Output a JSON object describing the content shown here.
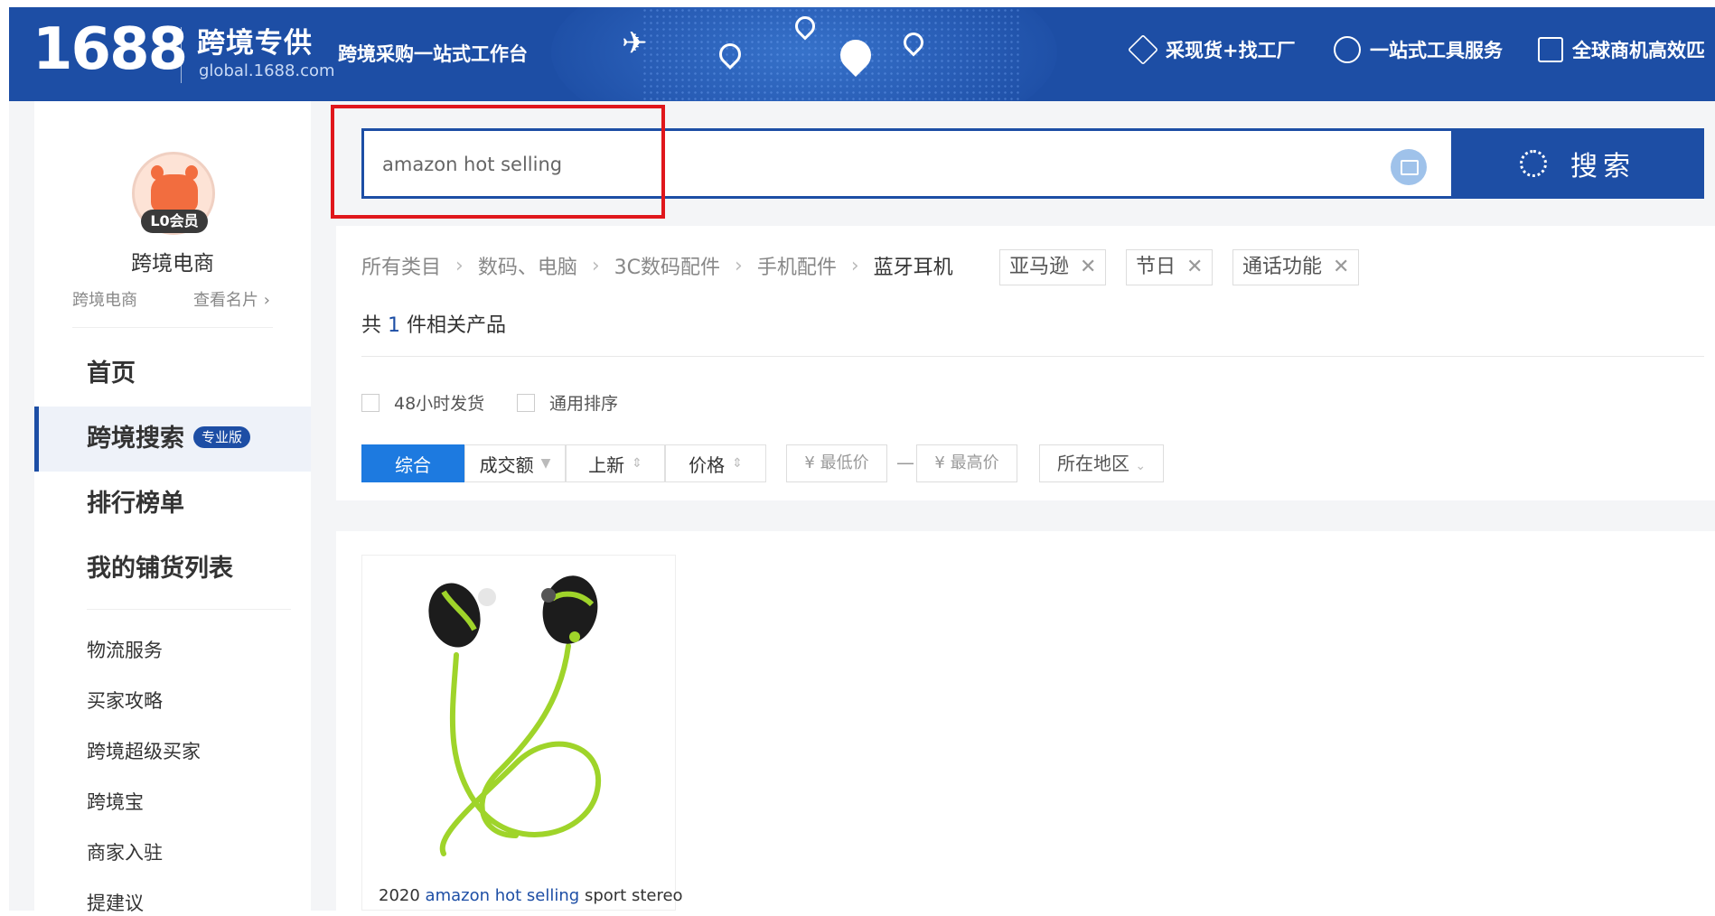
{
  "header": {
    "logo_number": "1688",
    "logo_title": "跨境专供",
    "logo_domain": "global.1688.com",
    "slogan": "跨境采购一站式工作台",
    "nav": [
      {
        "label": "采现货+找工厂",
        "icon": "diamond-icon"
      },
      {
        "label": "一站式工具服务",
        "icon": "pie-chart-icon"
      },
      {
        "label": "全球商机高效匹",
        "icon": "box-icon"
      }
    ]
  },
  "sidebar": {
    "member_badge": "L0会员",
    "user_name": "跨境电商",
    "user_type": "跨境电商",
    "view_card": "查看名片",
    "menu": [
      {
        "label": "首页"
      },
      {
        "label": "跨境搜索",
        "badge": "专业版"
      },
      {
        "label": "排行榜单"
      },
      {
        "label": "我的铺货列表"
      }
    ],
    "sub_items": [
      "物流服务",
      "买家攻略",
      "跨境超级买家",
      "跨境宝",
      "商家入驻",
      "提建议"
    ]
  },
  "search": {
    "value": "amazon hot selling",
    "button_label": "搜索"
  },
  "breadcrumb": [
    "所有类目",
    "数码、电脑",
    "3C数码配件",
    "手机配件",
    "蓝牙耳机"
  ],
  "filter_tags": [
    "亚马逊",
    "节日",
    "通话功能"
  ],
  "result_count": {
    "prefix": "共",
    "count": "1",
    "suffix": "件相关产品"
  },
  "checkboxes": [
    "48小时发货",
    "通用排序"
  ],
  "sort": {
    "tabs": [
      "综合",
      "成交额",
      "上新",
      "价格"
    ],
    "min_price_placeholder": "¥ 最低价",
    "max_price_placeholder": "¥ 最高价",
    "dash": "—",
    "region": "所在地区"
  },
  "products": [
    {
      "title_prefix": "2020",
      "title_keyword": "amazon hot selling",
      "title_suffix": "sport stereo"
    }
  ],
  "colors": {
    "brand": "#1d4ea5",
    "active_sort": "#1d7ae0",
    "highlight": "#e0171c",
    "earphone_green": "#9fd42a"
  }
}
